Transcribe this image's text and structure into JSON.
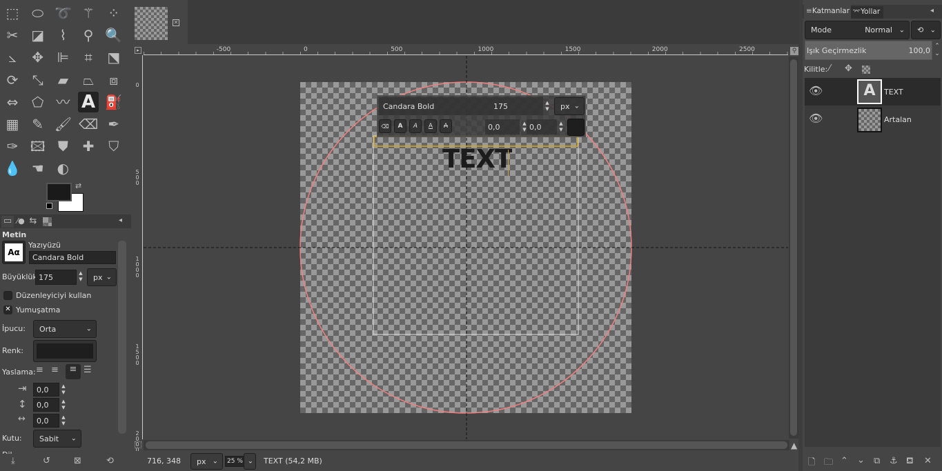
{
  "toolbox": {
    "tools": [
      "rect-select",
      "ellipse-select",
      "free-select",
      "fuzzy-select",
      "select-by-color",
      "scissors",
      "foreground-select",
      "paths",
      "color-picker",
      "zoom",
      "measure",
      "move",
      "align",
      "crop",
      "unified-transform",
      "rotate",
      "scale",
      "shear",
      "perspective",
      "3d-transform",
      "flip",
      "cage",
      "warp",
      "text",
      "bucket-fill",
      "gradient",
      "pencil",
      "paintbrush",
      "eraser",
      "airbrush",
      "ink",
      "mypaint-brush",
      "clone",
      "heal",
      "perspective-clone",
      "blur",
      "smudge",
      "dodge-burn"
    ],
    "fg_color": "#1a1a1a",
    "bg_color": "#ffffff"
  },
  "tool_options": {
    "title": "Metin",
    "font_label": "Yazıyüzü",
    "font_preview": "Aα",
    "font_value": "Candara Bold",
    "size_label": "Büyüklük:",
    "size_value": "175",
    "size_unit": "px",
    "use_editor": "Düzenleyiciyi kullan",
    "antialias": "Yumuşatma",
    "hinting_label": "İpucu:",
    "hinting_value": "Orta",
    "color_label": "Renk:",
    "color_value": "#1e1e1e",
    "justify_label": "Yaslama:",
    "indent": "0,0",
    "line_spacing": "0,0",
    "letter_spacing": "0,0",
    "box_label": "Kutu:",
    "box_value": "Sabit",
    "cut_label": "Dil"
  },
  "canvas": {
    "ruler_h": [
      "-500",
      "0",
      "500",
      "1000",
      "1500",
      "2000",
      "2500"
    ],
    "ruler_v": [
      "0",
      "500",
      "1000",
      "1500",
      "2000"
    ],
    "text_content": "TEXT",
    "text_toolbar": {
      "font": "Candara Bold",
      "size": "175",
      "unit": "px",
      "baseline": "0,0",
      "kerning": "0,0",
      "color": "#1e1e1e"
    }
  },
  "status": {
    "coords": "716, 348",
    "unit": "px",
    "zoom": "25 %",
    "info": "TEXT (54,2 MB)"
  },
  "layers_panel": {
    "tabs": [
      "Katmanlar",
      "Yollar"
    ],
    "mode_label": "Mode",
    "mode_value": "Normal",
    "opacity_label": "Işık Geçirmezlik",
    "opacity_value": "100,0",
    "lock_label": "Kilitle:",
    "layers": [
      {
        "name": "TEXT",
        "visible": true
      },
      {
        "name": "Artalan",
        "visible": true
      }
    ]
  }
}
